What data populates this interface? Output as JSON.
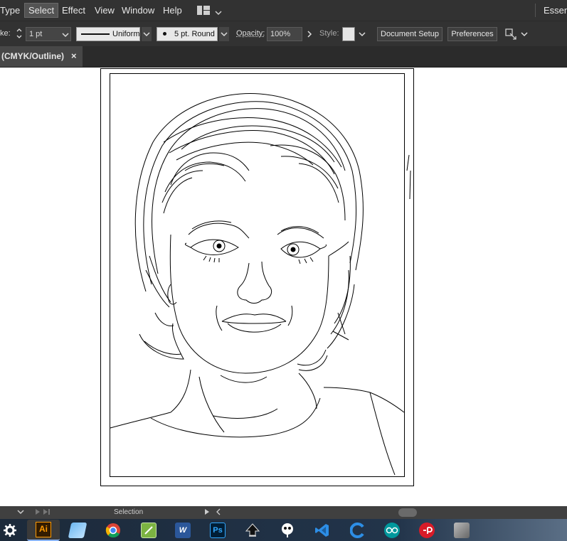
{
  "menubar": {
    "items": [
      {
        "label": "Type",
        "active": false
      },
      {
        "label": "Select",
        "active": true
      },
      {
        "label": "Effect",
        "active": false
      },
      {
        "label": "View",
        "active": false
      },
      {
        "label": "Window",
        "active": false
      },
      {
        "label": "Help",
        "active": false
      }
    ],
    "workspace_label": "Essent"
  },
  "controlbar": {
    "stroke_label": "ke:",
    "stroke_weight": "1 pt",
    "profile_label": "Uniform",
    "brush_label": "5 pt. Round",
    "opacity_label": "Opacity:",
    "opacity_value": "100%",
    "style_label": "Style:",
    "document_setup_label": "Document Setup",
    "preferences_label": "Preferences"
  },
  "tabbar": {
    "tab_title": "(CMYK/Outline)",
    "close_glyph": "×"
  },
  "statusbar": {
    "tool_label": "Selection"
  },
  "taskbar": {
    "icons": [
      "settings-icon",
      "illustrator-icon",
      "notepad-icon",
      "chrome-icon",
      "notes-icon",
      "word-icon",
      "photoshop-icon",
      "inkscape-icon",
      "gimp-icon",
      "vscode-icon",
      "c-icon",
      "arduino-icon",
      "app-icon",
      "misc-icon"
    ],
    "ai_label": "Ai",
    "ps_label": "Ps",
    "word_label": "W"
  },
  "colors": {
    "ui_dark": "#323232",
    "artboard_stroke": "#000000",
    "illustrator_orange": "#ff9a00",
    "photoshop_blue": "#31a8ff"
  }
}
